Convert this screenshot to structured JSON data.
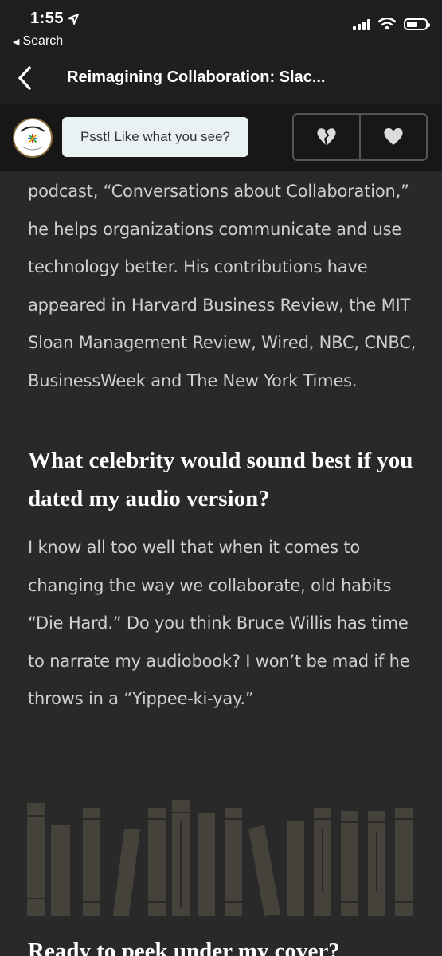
{
  "status_bar": {
    "time": "1:55",
    "back_label": "Search"
  },
  "nav": {
    "title": "Reimagining Collaboration: Slac..."
  },
  "feedback": {
    "prompt": "Psst! Like what you see?",
    "dislike_icon": "broken-heart-icon",
    "like_icon": "heart-icon"
  },
  "content": {
    "paragraph_1": "podcast, “Conversations about Collaboration,” he helps organizations communicate and use technology better. His contributions have appeared in Harvard Business Review, the MIT Sloan Management Review, Wired, NBC, CNBC, BusinessWeek and The New York Times.",
    "heading_1": "What celebrity would sound best if you dated my audio version?",
    "paragraph_2": "I know all too well that when it comes to changing the way we collaborate, old habits “Die Hard.” Do you think Bruce Willis has time to narrate my audiobook? I won’t be mad if he throws in a “Yippee-ki-yay.”",
    "heading_2": "Ready to peek under my cover?"
  },
  "colors": {
    "background": "#292929",
    "header": "#1f1f1f",
    "feedback_bar": "#171717",
    "bubble": "#eaf1f3",
    "book_spines": "#45413b"
  }
}
